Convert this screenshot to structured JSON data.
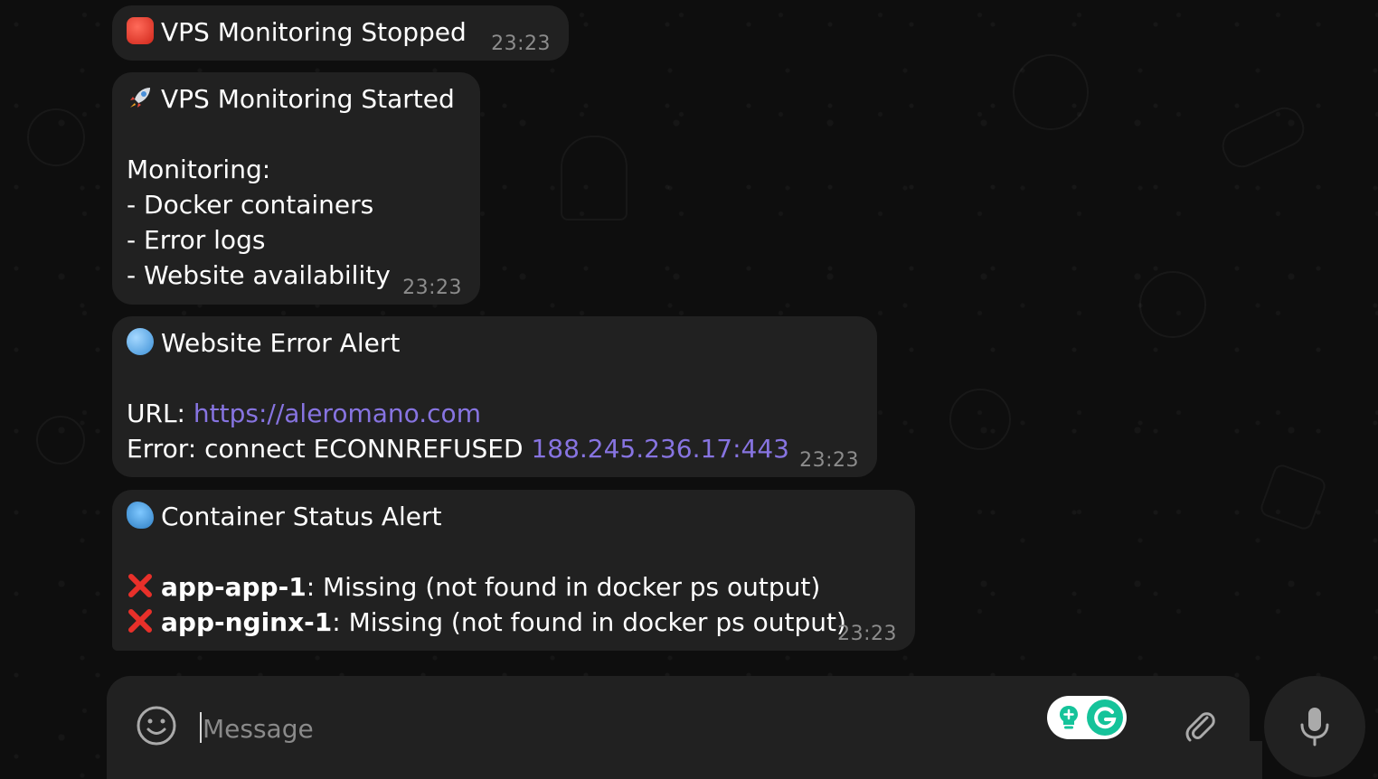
{
  "messages": [
    {
      "icon": "stop-sign-icon",
      "lines": [
        "VPS Monitoring Stopped"
      ],
      "time": "23:23"
    },
    {
      "icon": "rocket-icon",
      "title": "VPS Monitoring Started",
      "lines": [
        "Monitoring:",
        "- Docker containers",
        "- Error logs",
        "- Website availability"
      ],
      "time": "23:23"
    },
    {
      "icon": "globe-icon",
      "title": "Website Error Alert",
      "url_label": "URL: ",
      "url": "https://aleromano.com",
      "error_label": "Error: connect ECONNREFUSED ",
      "error_address": "188.245.236.17:443",
      "time": "23:23"
    },
    {
      "icon": "whale-icon",
      "title": "Container Status Alert",
      "items": [
        {
          "icon": "cross-mark-icon",
          "name": "app-app-1",
          "status": ": Missing (not found in docker ps output)"
        },
        {
          "icon": "cross-mark-icon",
          "name": "app-nginx-1",
          "status": ": Missing (not found in docker ps output)"
        }
      ],
      "time": "23:23"
    }
  ],
  "composer": {
    "placeholder": "Message",
    "emoji_icon": "smiley-icon",
    "extension_icon": "grammarly-icon",
    "attach_icon": "paperclip-icon",
    "voice_icon": "microphone-icon"
  },
  "colors": {
    "background": "#0e0e0e",
    "bubble": "#212121",
    "link": "#8774e1",
    "timestamp": "#8c8c8c",
    "icon": "#aaaaaa"
  }
}
